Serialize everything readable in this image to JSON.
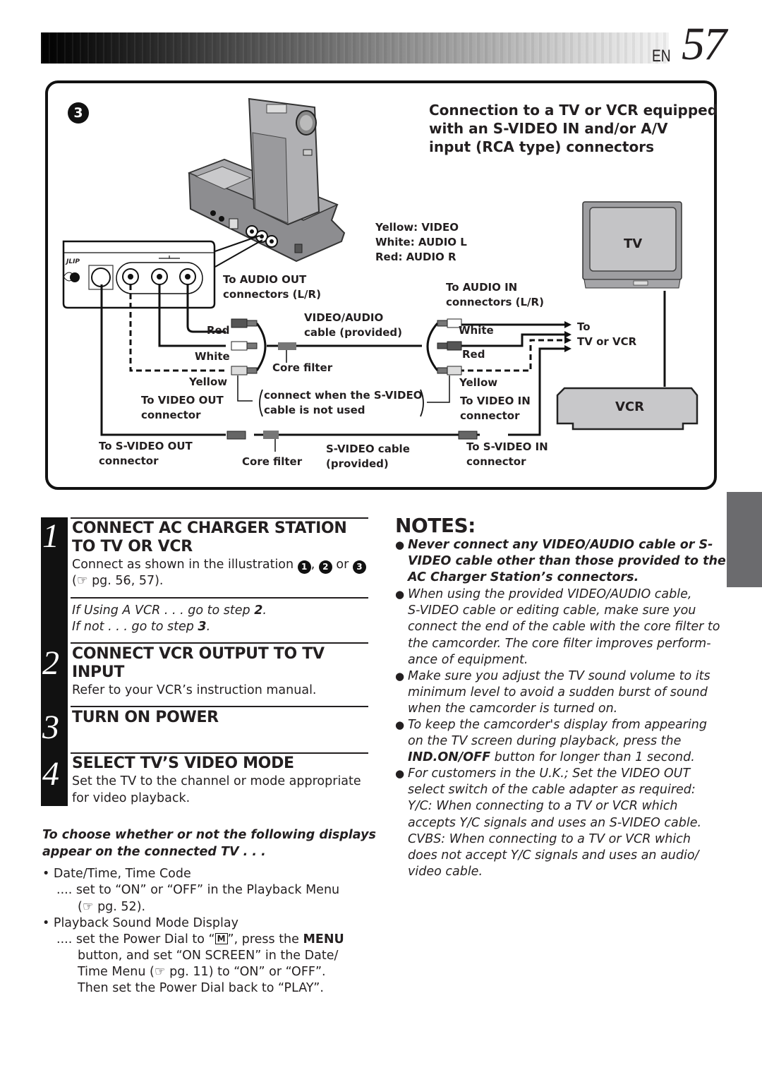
{
  "header": {
    "lang_code": "EN",
    "page_number": "57"
  },
  "diagram": {
    "illustration_number": "3",
    "title": "Connection to a TV or VCR equipped\nwith an S-VIDEO IN and/or A/V\ninput (RCA type) connectors",
    "color_key": [
      "Yellow: VIDEO",
      "White: AUDIO L",
      "Red: AUDIO R"
    ],
    "jlip_label": "JLIP",
    "left_labels": {
      "audio_out": "To AUDIO OUT\nconnectors (L/R)",
      "red": "Red",
      "white": "White",
      "yellow": "Yellow",
      "video_out": "To VIDEO OUT\nconnector",
      "svideo_out": "To S-VIDEO OUT\nconnector"
    },
    "center_labels": {
      "av_cable": "VIDEO/AUDIO\ncable (provided)",
      "core_filter_1": "Core filter",
      "connect_note": "connect when the S-VIDEO\ncable is not used",
      "core_filter_2": "Core filter",
      "svideo_cable": "S-VIDEO cable\n(provided)"
    },
    "right_labels": {
      "audio_in": "To AUDIO IN\nconnectors (L/R)",
      "white": "White",
      "red": "Red",
      "yellow": "Yellow",
      "video_in": "To VIDEO IN\nconnector",
      "svideo_in": "To S-VIDEO IN\nconnector",
      "to_tv_vcr": "To\nTV or VCR"
    },
    "tv_label": "TV",
    "vcr_label": "VCR"
  },
  "steps": [
    {
      "number": "1",
      "heading": "CONNECT AC CHARGER STATION\nTO TV OR VCR",
      "body_prefix": "Connect as shown in the illustration",
      "refs": [
        "1",
        "2",
        "3"
      ],
      "ref_sep": ",",
      "ref_or": "or",
      "page_ref": "(☞ pg. 56, 57).",
      "branch_1": "If Using A VCR . . . go to step ",
      "branch_1_step": "2",
      "branch_2": "If not . . . go to step ",
      "branch_2_step": "3"
    },
    {
      "number": "2",
      "heading": "CONNECT VCR OUTPUT TO TV\nINPUT",
      "body": "Refer to your VCR’s instruction manual."
    },
    {
      "number": "3",
      "heading": "TURN ON POWER"
    },
    {
      "number": "4",
      "heading": "SELECT TV’S VIDEO MODE",
      "body": "Set the TV to the channel or mode appropriate\nfor video playback."
    }
  ],
  "display_options": {
    "intro": "To choose whether or not the following displays\nappear on the connected TV . . .",
    "items": [
      {
        "label": "Date/Time, Time Code",
        "detail": ".... set to “ON” or “OFF” in the Playback Menu",
        "detail_2": "(☞ pg. 52)."
      },
      {
        "label": "Playback Sound Mode Display",
        "detail_a": ".... set the Power Dial to “",
        "dial_icon": "M",
        "detail_b": "”, press the ",
        "detail_bold": "MENU",
        "detail_2": "button, and set “ON SCREEN” in the Date/",
        "detail_3": "Time Menu (☞ pg. 11) to “ON” or “OFF”.",
        "detail_4": "Then set the Power Dial back to “PLAY”."
      }
    ]
  },
  "notes": {
    "title": "NOTES:",
    "items": [
      "Never connect any VIDEO/AUDIO cable or S-\nVIDEO cable other than those provided to the\nAC Charger Station’s connectors.",
      "When using the provided VIDEO/AUDIO cable,\nS-VIDEO cable or editing cable, make sure you\nconnect the end of the cable with the core filter to\nthe camcorder. The core filter improves perform-\nance of equipment.",
      "Make sure you adjust the TV sound volume to its\nminimum level to avoid a sudden burst of sound\nwhen the camcorder is turned on.",
      "For customers in the U.K.; Set the VIDEO OUT\nselect switch of the cable adapter as required:\nY/C: When connecting to a TV or VCR which\naccepts Y/C signals and uses an S-VIDEO cable.\nCVBS: When connecting to a TV or VCR which\ndoes not accept Y/C signals and uses an audio/\nvideo cable."
    ],
    "item4_prefix": "To keep the camcorder's display from appearing\non the TV screen during playback, press the\n",
    "item4_bold": "IND.ON/OFF",
    "item4_suffix": " button for longer than 1 second."
  }
}
